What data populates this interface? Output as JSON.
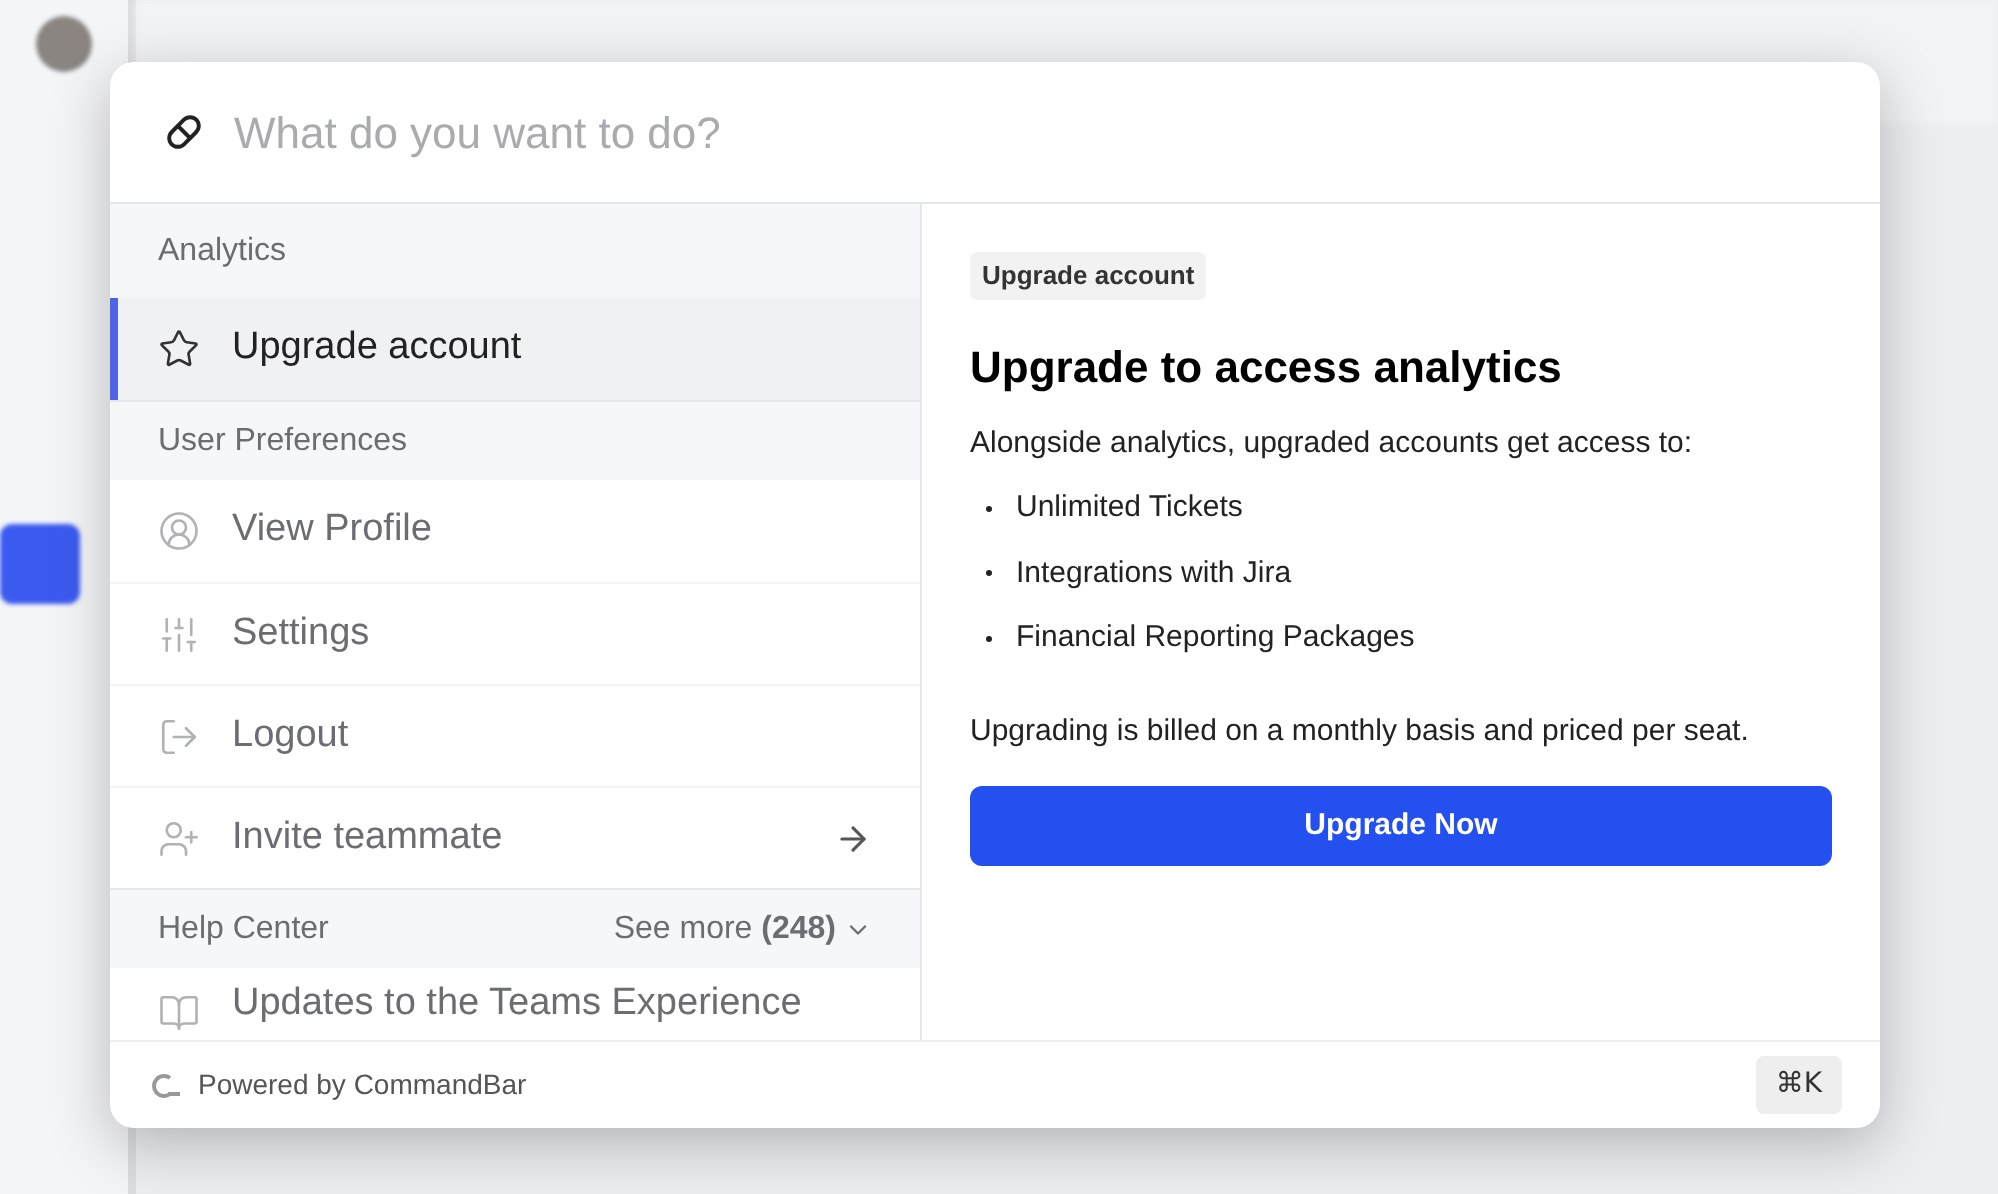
{
  "search": {
    "placeholder": "What do you want to do?"
  },
  "groups": [
    {
      "title": "Analytics",
      "items": [
        {
          "label": "Upgrade account",
          "selected": true,
          "trailing_arrow": false
        }
      ]
    },
    {
      "title": "User Preferences",
      "items": [
        {
          "label": "View Profile",
          "selected": false,
          "trailing_arrow": false
        },
        {
          "label": "Settings",
          "selected": false,
          "trailing_arrow": false
        },
        {
          "label": "Logout",
          "selected": false,
          "trailing_arrow": false
        },
        {
          "label": "Invite teammate",
          "selected": false,
          "trailing_arrow": true
        }
      ]
    },
    {
      "title": "Help Center",
      "see_more": "See more **(248)**",
      "items": [
        {
          "label": "Updates to the Teams Experience",
          "selected": false,
          "trailing_arrow": false
        }
      ]
    }
  ],
  "detail": {
    "tag": "Upgrade account",
    "heading": "Upgrade to access analytics",
    "intro": "Alongside analytics, upgraded accounts get access to:",
    "bullets": [
      "Unlimited Tickets",
      "Integrations with Jira",
      "Financial Reporting Packages"
    ],
    "note": "Upgrading is billed on a monthly basis and priced per seat.",
    "button": "Upgrade Now"
  },
  "footer": {
    "brand": "Powered by CommandBar",
    "shortcut": "⌘K"
  }
}
